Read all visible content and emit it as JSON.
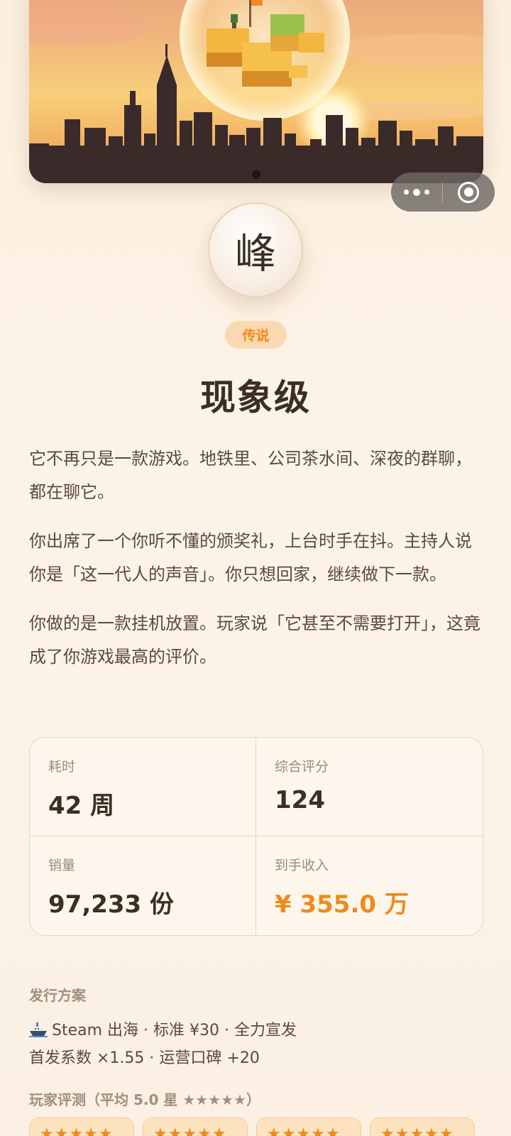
{
  "capsule": {
    "more_icon": "more-dots-icon",
    "close_icon": "record-target-icon"
  },
  "avatar": {
    "char": "峰"
  },
  "badge": "传说",
  "title": "现象级",
  "story": [
    "它不再只是一款游戏。地铁里、公司茶水间、深夜的群聊，都在聊它。",
    "你出席了一个你听不懂的颁奖礼，上台时手在抖。主持人说你是「这一代人的声音」。你只想回家，继续做下一款。",
    "你做的是一款挂机放置。玩家说「它甚至不需要打开」，这竟成了你游戏最高的评价。"
  ],
  "stats": [
    {
      "label": "耗时",
      "value": "42 周"
    },
    {
      "label": "综合评分",
      "value": "124"
    },
    {
      "label": "销量",
      "value": "97,233 份"
    },
    {
      "label": "到手收入",
      "value": "¥ 355.0 万"
    }
  ],
  "release": {
    "heading": "发行方案",
    "line1": "Steam 出海 · 标准 ¥30 · 全力宣发",
    "line2": "首发系数 ×1.55 · 运营口碑 +20"
  },
  "reviews": {
    "heading": "玩家评测（平均 5.0 星 ★★★★★）",
    "chips": [
      "★★★★★",
      "★★★★★",
      "★★★★★",
      "★★★★★"
    ]
  },
  "colors": {
    "accent": "#ef8a1e",
    "background": "#fbf1e4",
    "text": "#3a2e25"
  }
}
